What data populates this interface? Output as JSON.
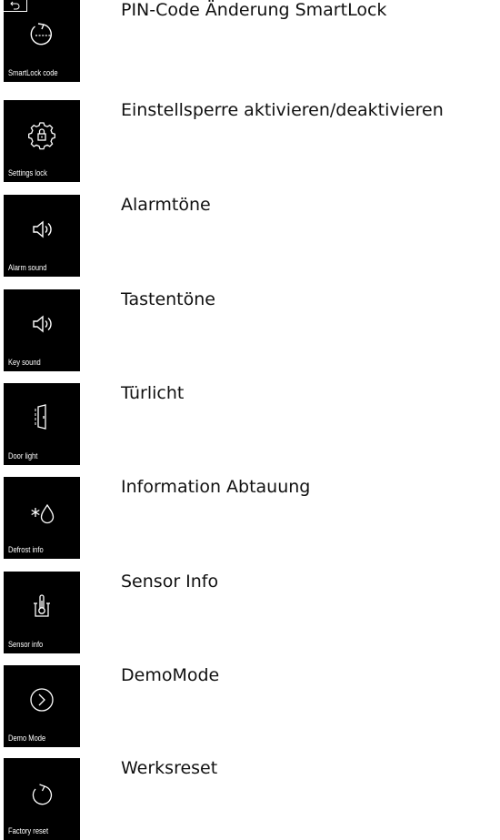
{
  "items": [
    {
      "tile_label": "SmartLock code",
      "description": "PIN-Code Änderung SmartLock",
      "icon": "smartlock-icon",
      "has_back": true
    },
    {
      "tile_label": "Settings lock",
      "description": "Einstellsperre aktivieren/deaktivieren",
      "icon": "settings-lock-icon"
    },
    {
      "tile_label": "Alarm sound",
      "description": "Alarmtöne",
      "icon": "speaker-icon"
    },
    {
      "tile_label": "Key sound",
      "description": "Tastentöne",
      "icon": "speaker-icon"
    },
    {
      "tile_label": "Door light",
      "description": "Türlicht",
      "icon": "door-light-icon"
    },
    {
      "tile_label": "Defrost info",
      "description": "Information Abtauung",
      "icon": "defrost-icon"
    },
    {
      "tile_label": "Sensor info",
      "description": "Sensor Info",
      "icon": "thermometer-icon"
    },
    {
      "tile_label": "Demo Mode",
      "description": "DemoMode",
      "icon": "demo-mode-icon"
    },
    {
      "tile_label": "Factory reset",
      "description": "Werksreset",
      "icon": "factory-reset-icon"
    }
  ],
  "colors": {
    "tile_background": "#000000",
    "tile_foreground": "#ffffff",
    "text": "#111111"
  }
}
